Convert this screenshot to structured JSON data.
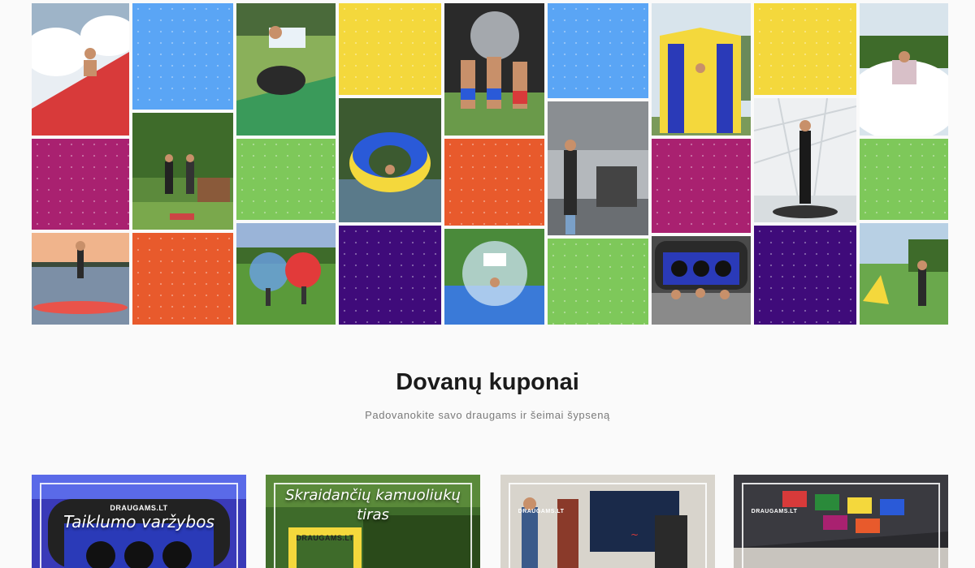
{
  "mosaic": {
    "tiles": [
      {
        "name": "photo-foam-party",
        "kind": "photo",
        "photo": "foam"
      },
      {
        "name": "color-tile-blue-1",
        "kind": "color",
        "color": "#5aa5f5"
      },
      {
        "name": "photo-rodeo-bull",
        "kind": "photo",
        "photo": "rodeo"
      },
      {
        "name": "color-tile-yellow-1",
        "kind": "color",
        "color": "#f4d83c"
      },
      {
        "name": "photo-water-splash",
        "kind": "photo",
        "photo": "splash"
      },
      {
        "name": "color-tile-blue-2",
        "kind": "color",
        "color": "#5aa5f5"
      },
      {
        "name": "photo-inflatable-slide",
        "kind": "photo",
        "photo": "slide"
      },
      {
        "name": "color-tile-yellow-2",
        "kind": "color",
        "color": "#f4d83c"
      },
      {
        "name": "photo-foam-field",
        "kind": "photo",
        "photo": "foamfield"
      },
      {
        "name": "color-tile-magenta-1",
        "kind": "color",
        "color": "#a92170"
      },
      {
        "name": "photo-garden-game",
        "kind": "photo",
        "photo": "garden"
      },
      {
        "name": "color-tile-green-1",
        "kind": "color",
        "color": "#7ec85a"
      },
      {
        "name": "photo-water-wheel",
        "kind": "photo",
        "photo": "wheel"
      },
      {
        "name": "color-tile-orange-1",
        "kind": "color",
        "color": "#e85a2c"
      },
      {
        "name": "photo-street-machine",
        "kind": "photo",
        "photo": "street"
      },
      {
        "name": "color-tile-magenta-2",
        "kind": "color",
        "color": "#a92170"
      },
      {
        "name": "photo-360-booth",
        "kind": "photo",
        "photo": "booth"
      },
      {
        "name": "color-tile-green-2",
        "kind": "color",
        "color": "#7ec85a"
      },
      {
        "name": "photo-paddleboard",
        "kind": "photo",
        "photo": "sup"
      },
      {
        "name": "color-tile-orange-2",
        "kind": "color",
        "color": "#e85a2c"
      },
      {
        "name": "photo-bubble-football",
        "kind": "photo",
        "photo": "bubble"
      },
      {
        "name": "color-tile-purple-1",
        "kind": "color",
        "color": "#3f0b7a"
      },
      {
        "name": "photo-water-ball",
        "kind": "photo",
        "photo": "waterball"
      },
      {
        "name": "color-tile-green-3",
        "kind": "color",
        "color": "#7ec85a"
      },
      {
        "name": "photo-accuracy-game",
        "kind": "photo",
        "photo": "target"
      },
      {
        "name": "color-tile-purple-2",
        "kind": "color",
        "color": "#3f0b7a"
      },
      {
        "name": "photo-archery-tag",
        "kind": "photo",
        "photo": "archery"
      }
    ]
  },
  "section": {
    "title": "Dovanų kuponai",
    "subtitle": "Padovanokite savo draugams ir šeimai šypseną"
  },
  "cards": [
    {
      "title": "Taiklumo varžybos",
      "brand": "DRAUGAMS.LT",
      "photo": "target-card"
    },
    {
      "title": "Skraidančių kamuoliukų tiras",
      "brand": "DRAUGAMS.LT",
      "photo": "balls-card"
    },
    {
      "title": "",
      "brand": "DRAUGAMS.LT",
      "photo": "vr-card"
    },
    {
      "title": "",
      "brand": "DRAUGAMS.LT",
      "photo": "room-card"
    }
  ]
}
